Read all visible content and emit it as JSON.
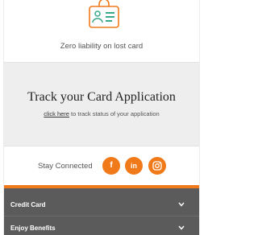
{
  "feature": {
    "icon": "id-card-icon",
    "text": "Zero liability on lost card"
  },
  "track": {
    "title": "Track your Card Application",
    "link_text": "click here",
    "suffix_text": " to track status of your application"
  },
  "social": {
    "label": "Stay Connected",
    "buttons": [
      {
        "name": "facebook",
        "glyph": "f"
      },
      {
        "name": "linkedin",
        "glyph": "in"
      },
      {
        "name": "instagram",
        "glyph": "instagram-icon"
      }
    ]
  },
  "footer": {
    "items": [
      {
        "label": "Credit Card"
      },
      {
        "label": "Enjoy Benefits"
      }
    ]
  },
  "colors": {
    "accent": "#f07a1a",
    "icon_green": "#3aa88a",
    "footer_bg": "#5b5b5b",
    "track_bg": "#eeeeee"
  }
}
